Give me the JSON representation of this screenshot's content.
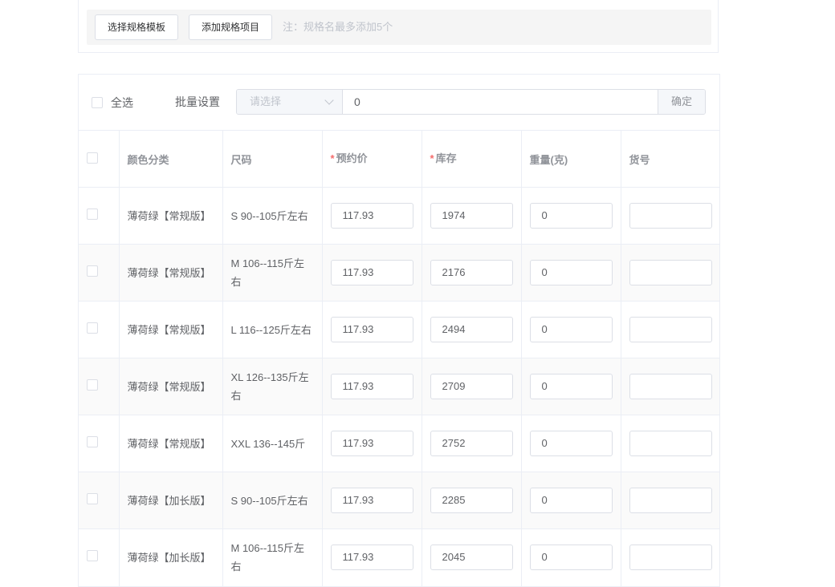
{
  "spec_toolbar": {
    "select_template_label": "选择规格模板",
    "add_spec_item_label": "添加规格项目",
    "note": "注：规格名最多添加5个"
  },
  "batch": {
    "select_all_label": "全选",
    "batch_set_label": "批量设置",
    "select_placeholder": "请选择",
    "input_value": "0",
    "confirm_label": "确定"
  },
  "table": {
    "required_mark": "*",
    "headers": {
      "color": "颜色分类",
      "size": "尺码",
      "price": "预约价",
      "stock": "库存",
      "weight": "重量(克)",
      "code": "货号"
    },
    "rows": [
      {
        "color": "薄荷绿【常规版】",
        "size": "S 90--105斤左右",
        "price": "117.93",
        "stock": "1974",
        "weight": "0",
        "code": ""
      },
      {
        "color": "薄荷绿【常规版】",
        "size": "M 106--115斤左右",
        "price": "117.93",
        "stock": "2176",
        "weight": "0",
        "code": ""
      },
      {
        "color": "薄荷绿【常规版】",
        "size": "L 116--125斤左右",
        "price": "117.93",
        "stock": "2494",
        "weight": "0",
        "code": ""
      },
      {
        "color": "薄荷绿【常规版】",
        "size": "XL 126--135斤左右",
        "price": "117.93",
        "stock": "2709",
        "weight": "0",
        "code": ""
      },
      {
        "color": "薄荷绿【常规版】",
        "size": "XXL 136--145斤",
        "price": "117.93",
        "stock": "2752",
        "weight": "0",
        "code": ""
      },
      {
        "color": "薄荷绿【加长版】",
        "size": "S 90--105斤左右",
        "price": "117.93",
        "stock": "2285",
        "weight": "0",
        "code": ""
      },
      {
        "color": "薄荷绿【加长版】",
        "size": "M 106--115斤左右",
        "price": "117.93",
        "stock": "2045",
        "weight": "0",
        "code": ""
      }
    ]
  }
}
